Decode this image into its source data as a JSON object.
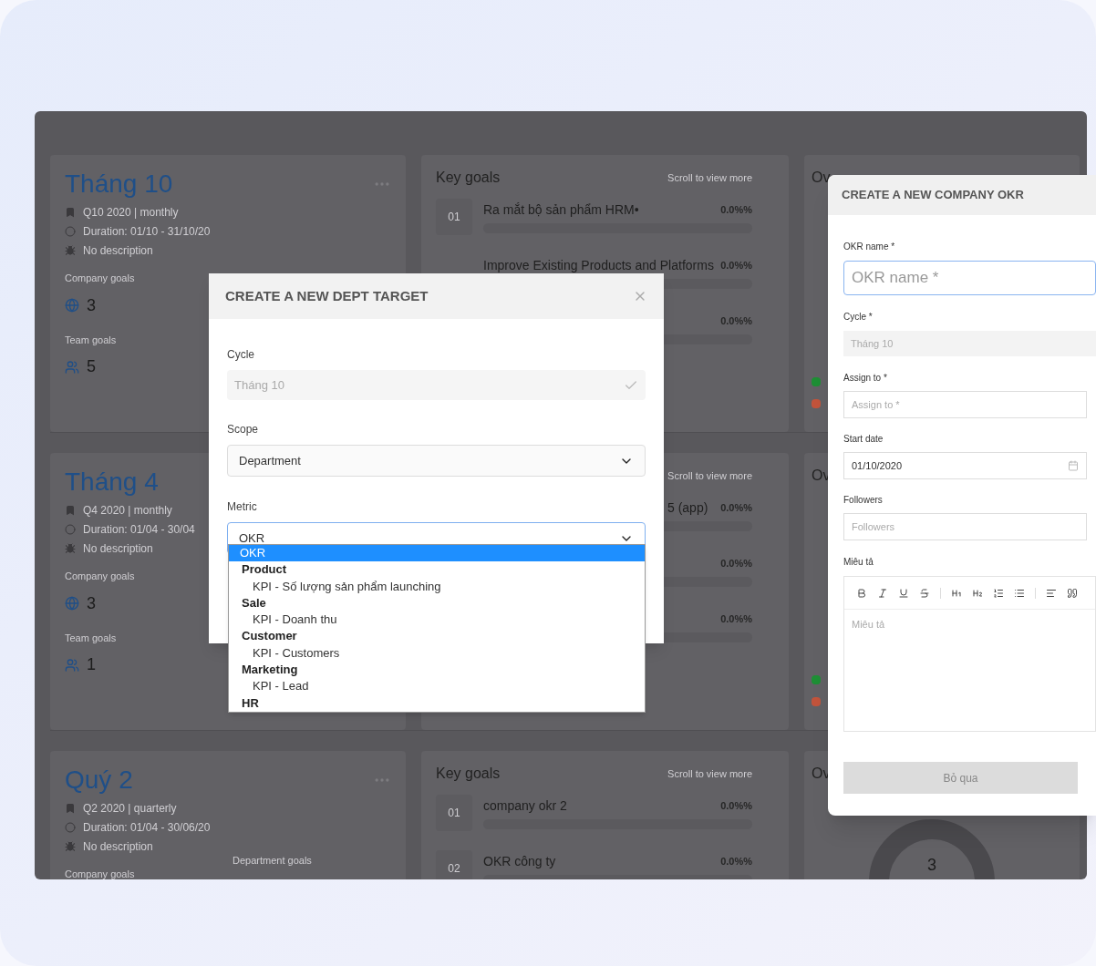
{
  "cycles": [
    {
      "title": "Tháng 10",
      "period": "Q10 2020 | monthly",
      "duration": "Duration: 01/10 - 31/10/20",
      "description": "No description",
      "company_goals_label": "Company goals",
      "company_goals": "3",
      "team_goals_label": "Team goals",
      "team_goals": "5",
      "key_goals": {
        "title": "Key goals",
        "hint": "Scroll to view more",
        "items": [
          {
            "index": "01",
            "name": "Ra mắt bộ sản phẩm HRM•",
            "progress": "0.0%%",
            "level": 0
          },
          {
            "name": "Improve Existing Products and Platforms",
            "progress": "0.0%%",
            "level": 0
          },
          {
            "progress": "0.0%%",
            "level": 0
          }
        ]
      },
      "overview": {
        "title": "Ov",
        "legend": [
          {
            "color": "#1e8f35"
          },
          {
            "color": "#c2543c"
          }
        ]
      }
    },
    {
      "title": "Tháng 4",
      "period": "Q4 2020 | monthly",
      "duration": "Duration: 01/04 - 30/04",
      "description": "No description",
      "company_goals_label": "Company goals",
      "company_goals": "3",
      "team_goals_label": "Team goals",
      "team_goals": "1",
      "key_goals": {
        "hint": "Scroll to view more",
        "items": [
          {
            "name": "5 (app)",
            "progress": "0.0%%",
            "level": 0
          },
          {
            "progress": "0.0%%",
            "level": 0
          },
          {
            "progress": "0.0%%",
            "level": 0
          }
        ]
      },
      "overview": {
        "title": "Ov",
        "legend": [
          {
            "color": "#1e8f35"
          },
          {
            "color": "#c2543c"
          }
        ]
      }
    },
    {
      "title": "Quý 2",
      "period": "Q2 2020 | quarterly",
      "duration": "Duration: 01/04 - 30/06/20",
      "description": "No description",
      "company_goals_label": "Company goals",
      "department_goals_label": "Department goals",
      "key_goals": {
        "title": "Key goals",
        "hint": "Scroll to view more",
        "items": [
          {
            "index": "01",
            "name": "company okr 2",
            "progress": "0.0%%",
            "level": 0
          },
          {
            "index": "02",
            "name": "OKR công ty",
            "progress": "0.0%%",
            "level": 0
          }
        ]
      },
      "overview": {
        "title": "Ov",
        "total": "3"
      }
    }
  ],
  "dept_modal": {
    "title": "CREATE A NEW DEPT TARGET",
    "cycle": {
      "label": "Cycle",
      "value": "Tháng 10",
      "disabled": true
    },
    "scope": {
      "label": "Scope",
      "value": "Department"
    },
    "metric": {
      "label": "Metric",
      "value": "OKR",
      "focused": true,
      "expanded": true,
      "options": [
        {
          "kind": "option",
          "label": "OKR",
          "selected": true
        },
        {
          "kind": "group",
          "label": "Product"
        },
        {
          "kind": "option",
          "label": "KPI - Số lượng sản phẩm launching",
          "selected": false
        },
        {
          "kind": "group",
          "label": "Sale"
        },
        {
          "kind": "option",
          "label": "KPI - Doanh thu",
          "selected": false
        },
        {
          "kind": "group",
          "label": "Customer"
        },
        {
          "kind": "option",
          "label": "KPI - Customers",
          "selected": false
        },
        {
          "kind": "group",
          "label": "Marketing"
        },
        {
          "kind": "option",
          "label": "KPI - Lead",
          "selected": false
        },
        {
          "kind": "group",
          "label": "HR"
        }
      ]
    }
  },
  "company_drawer": {
    "title": "CREATE A NEW COMPANY OKR",
    "okr_name": {
      "label": "OKR name *",
      "placeholder": "OKR name *",
      "focused": true
    },
    "cycle": {
      "label": "Cycle *",
      "value": "Tháng 10",
      "disabled": true
    },
    "assign_to": {
      "label": "Assign to *",
      "placeholder": "Assign to *"
    },
    "start_date": {
      "label": "Start date",
      "value": "01/10/2020"
    },
    "followers": {
      "label": "Followers",
      "placeholder": "Followers"
    },
    "description": {
      "label": "Miêu tả",
      "placeholder": "Miêu tả"
    },
    "cancel_button": "Bỏ qua"
  }
}
